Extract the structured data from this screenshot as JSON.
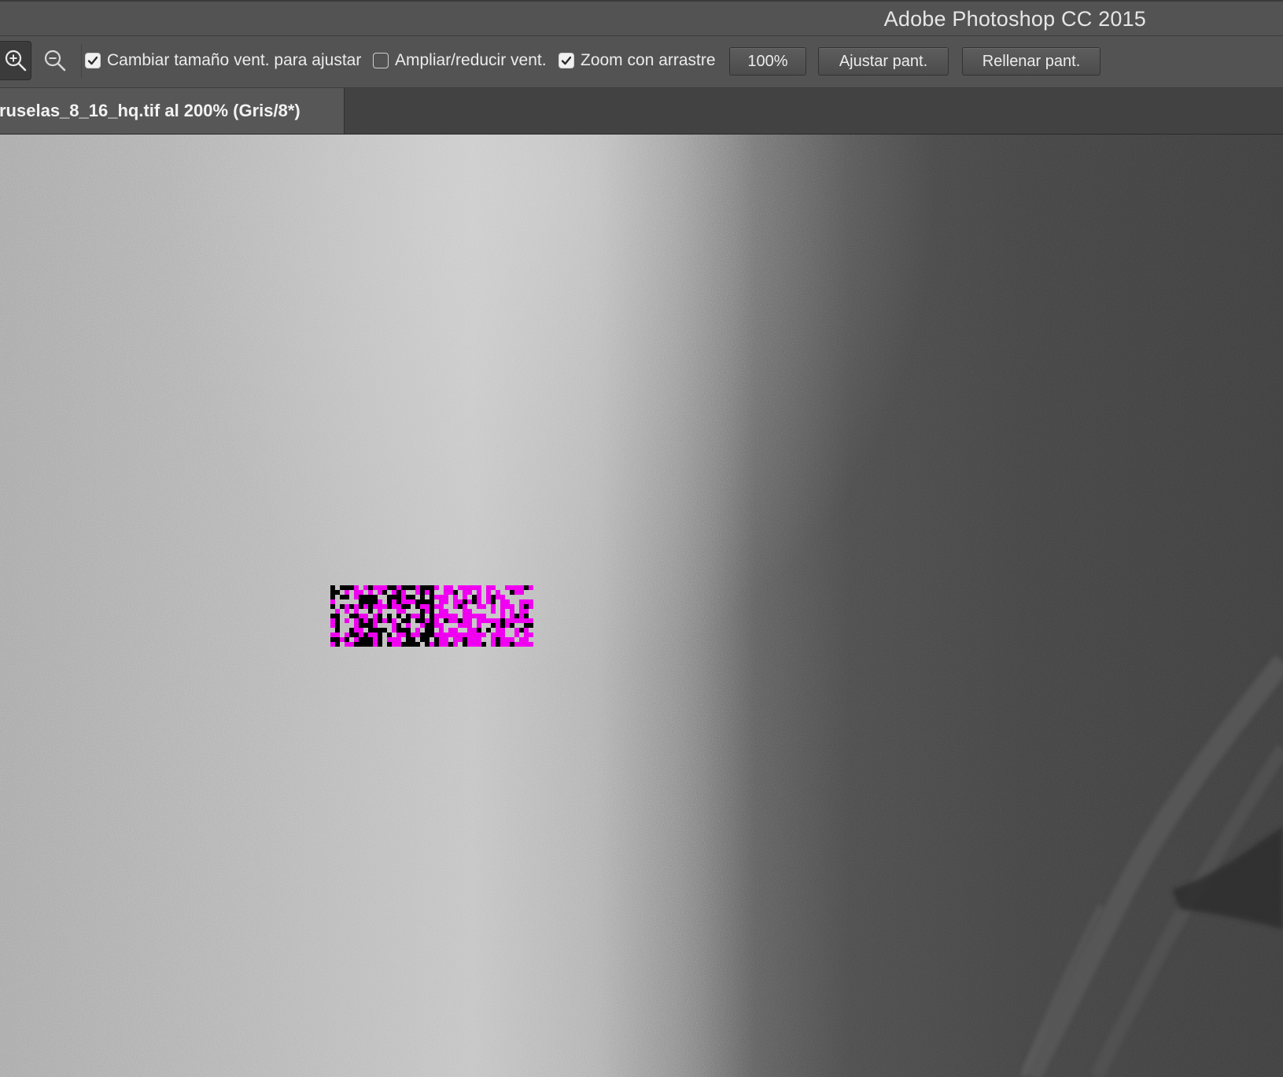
{
  "app": {
    "title": "Adobe Photoshop CC 2015"
  },
  "options_bar": {
    "tools": [
      {
        "icon": "zoom-in-icon",
        "active": true
      },
      {
        "icon": "zoom-out-icon",
        "active": false
      }
    ],
    "checkboxes": [
      {
        "label": "Cambiar tamaño vent. para ajustar",
        "checked": true
      },
      {
        "label": "Ampliar/reducir vent.",
        "checked": false
      },
      {
        "label": "Zoom con arrastre",
        "checked": true
      }
    ],
    "buttons": {
      "actual_pixels": "100%",
      "fit_screen": "Ajustar pant.",
      "fill_screen": "Rellenar pant."
    }
  },
  "document": {
    "tab_label": "ruselas_8_16_hq.tif al 200% (Gris/8*)",
    "zoom": "200%",
    "mode": "Gris/8*"
  },
  "colors": {
    "ui_panel": "#535353",
    "tab_bar": "#424242",
    "artifact_magenta": "#f000f0",
    "artifact_black": "#000000"
  }
}
